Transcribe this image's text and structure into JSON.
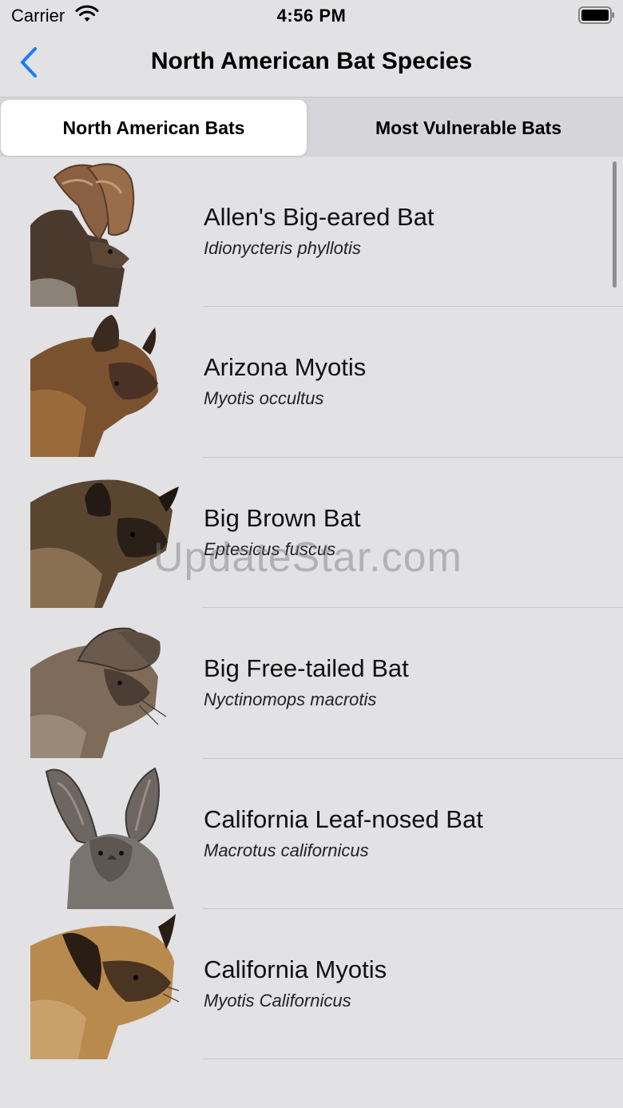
{
  "status_bar": {
    "carrier": "Carrier",
    "time": "4:56 PM"
  },
  "nav": {
    "title": "North American Bat Species",
    "back_icon": "chevron-left-icon"
  },
  "tabs": [
    {
      "label": "North American Bats",
      "selected": true
    },
    {
      "label": "Most Vulnerable Bats",
      "selected": false
    }
  ],
  "bats": [
    {
      "common_name": "Allen's Big-eared Bat",
      "scientific_name": "Idionycteris phyllotis"
    },
    {
      "common_name": "Arizona Myotis",
      "scientific_name": "Myotis occultus"
    },
    {
      "common_name": "Big Brown Bat",
      "scientific_name": "Eptesicus fuscus"
    },
    {
      "common_name": "Big Free-tailed Bat",
      "scientific_name": "Nyctinomops macrotis"
    },
    {
      "common_name": "California Leaf-nosed Bat",
      "scientific_name": "Macrotus californicus"
    },
    {
      "common_name": "California Myotis",
      "scientific_name": "Myotis Californicus"
    }
  ],
  "watermark": "UpdateStar.com",
  "colors": {
    "accent": "#1a7cf5",
    "background": "#e2e1e4",
    "segment_bg": "#d6d5d9"
  }
}
